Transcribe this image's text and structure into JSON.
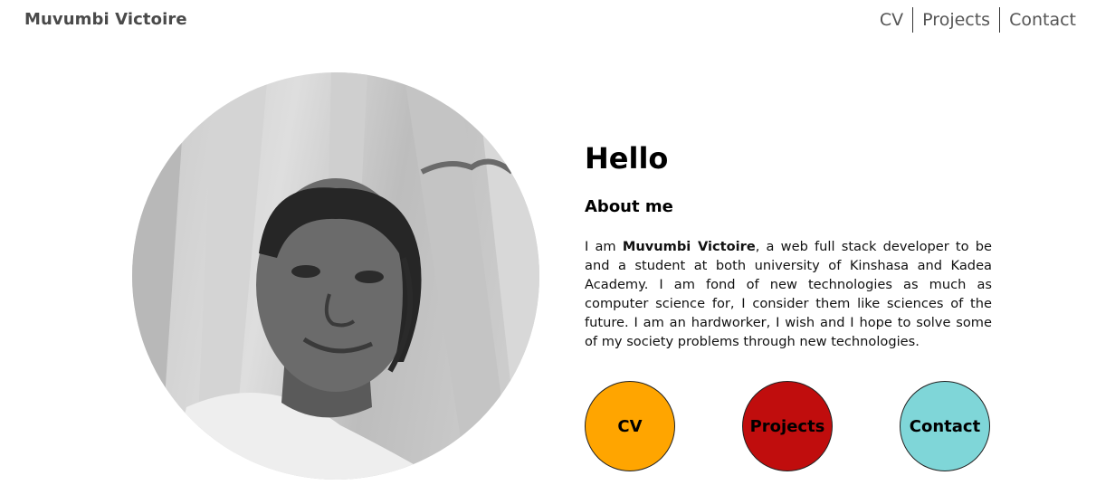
{
  "header": {
    "brand": "Muvumbi Victoire",
    "nav": [
      {
        "label": "CV"
      },
      {
        "label": "Projects"
      },
      {
        "label": "Contact"
      }
    ]
  },
  "main": {
    "greeting": "Hello",
    "about_title": "About me",
    "bio_prefix": "I am ",
    "bio_name": "Muvumbi Victoire",
    "bio_text": ", a web full stack developer to be and a student at both university of Kinshasa and Kadea Academy. I am fond of new technologies as much as computer science for, I consider them like sciences of the future. I am an hardworker, I wish and I hope to solve some of my society problems through new technologies."
  },
  "buttons": [
    {
      "label": "CV",
      "color": "#FFA500"
    },
    {
      "label": "Projects",
      "color": "#C00D0D"
    },
    {
      "label": "Contact",
      "color": "#7FD6D8"
    }
  ]
}
